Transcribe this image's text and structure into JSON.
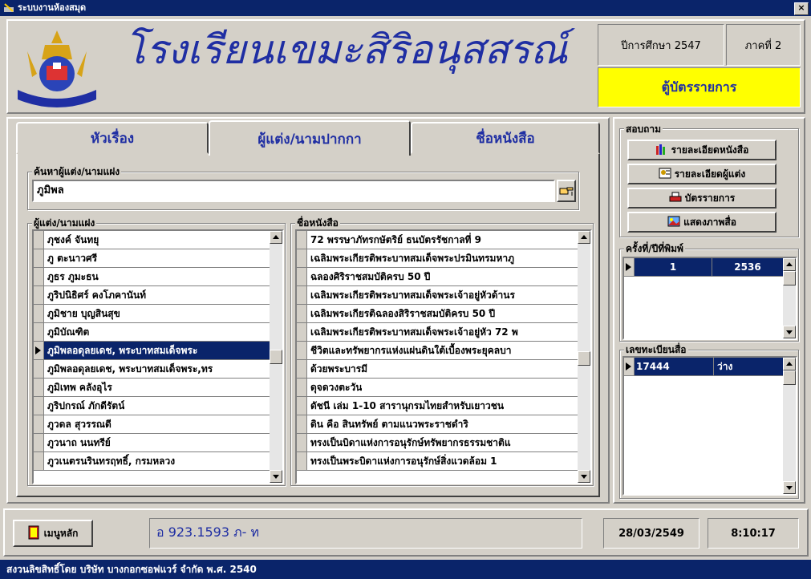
{
  "window": {
    "title": "ระบบงานห้องสมุด",
    "close_label": "×"
  },
  "header": {
    "school_name": "โรงเรียนเขมะสิริอนุสสรณ์",
    "academic_year": "ปีการศึกษา 2547",
    "term": "ภาคที่ 2",
    "section_title": "ตู้บัตรรายการ"
  },
  "tabs": [
    {
      "label": "หัวเรื่อง"
    },
    {
      "label": "ผู้แต่ง/นามปากกา"
    },
    {
      "label": "ชื่อหนังสือ"
    }
  ],
  "search": {
    "group_label": "ค้นหาผู้แต่ง/นามแฝง",
    "value": "ภูมิพล"
  },
  "authors": {
    "group_label": "ผู้แต่ง/นามแฝง",
    "selected_index": 6,
    "items": [
      "ภุชงค์ จันทยุ",
      "ภู ตะนาวศรี",
      "ภูธร ภูมะธน",
      "ภูริปนิธิศร์ คงโภคานันท์",
      "ภูมิชาย บุญสินสุข",
      "ภูมิบัณฑิต",
      "ภูมิพลอดุลยเดช, พระบาทสมเด็จพระ",
      "ภูมิพลอดุลยเดช, พระบาทสมเด็จพระ,ทร",
      "ภูมิเทพ คลังอุไร",
      "ภูริปกรณ์ ภักดีรัตน์",
      "ภูวดล สุวรรณดี",
      "ภูวนาถ นนทรีย์",
      "ภูวเนตรนรินทรฤทธิ์, กรมหลวง"
    ]
  },
  "titles": {
    "group_label": "ชื่อหนังสือ",
    "selected_index": 13,
    "items": [
      "72 พรรษาภัทรกษัตริย์ ธนบัตรรัชกาลที่ 9",
      "เฉลิมพระเกียรติพระบาทสมเด็จพระปรมินทรมหาภู",
      "ฉลองศิริราชสมบัติครบ 50 ปี",
      "เฉลิมพระเกียรติพระบาทสมเด็จพระเจ้าอยู่หัวด้านร",
      "เฉลิมพระเกียรติฉลองสิริราชสมบัติครบ 50 ปี",
      "เฉลิมพระเกียรติพระบาทสมเด็จพระเจ้าอยู่หัว 72 พ",
      "ชีวิตและทรัพยากรแห่งแผ่นดินใต้เบื้องพระยุคลบา",
      "ด้วยพระบารมี",
      "ดุจดวงตะวัน",
      "ดัชนี เล่ม 1-10 สารานุกรมไทยสำหรับเยาวชน",
      "ดิน คือ สินทรัพย์ ตามแนวพระราชดำริ",
      "ทรงเป็นบิดาแห่งการอนุรักษ์ทรัพยากรธรรมชาติแ",
      "ทรงเป็นพระบิดาแห่งการอนุรักษ์สิ่งแวดล้อม 1"
    ]
  },
  "inquiry": {
    "group_label": "สอบถาม",
    "buttons": [
      "รายละเอียดหนังสือ",
      "รายละเอียดผู้แต่ง",
      "บัตรรายการ",
      "แสดงภาพสื่อ"
    ]
  },
  "editions": {
    "group_label": "ครั้งที่/ปีที่พิมพ์",
    "rows": [
      {
        "edition": "1",
        "year": "2536"
      }
    ]
  },
  "registers": {
    "group_label": "เลขทะเบียนสื่อ",
    "rows": [
      {
        "number": "17444",
        "status": "ว่าง"
      }
    ]
  },
  "footer": {
    "menu_label": "เมนูหลัก",
    "call_number": "อ 923.1593 ภ- ท",
    "date": "28/03/2549",
    "time": "8:10:17"
  },
  "status": {
    "copyright": "สงวนลิขสิทธิ์โดย บริษัท บางกอกซอฟแวร์ จำกัด พ.ศ. 2540"
  },
  "colors": {
    "accent_blue": "#1f2ea3",
    "highlight_yellow": "#ffff00",
    "selection": "#0a246a"
  },
  "icons": [
    "app-icon",
    "school-crest-icon",
    "pointing-hand-icon",
    "books-icon",
    "author-icon",
    "printer-icon",
    "picture-icon",
    "door-exit-icon"
  ]
}
